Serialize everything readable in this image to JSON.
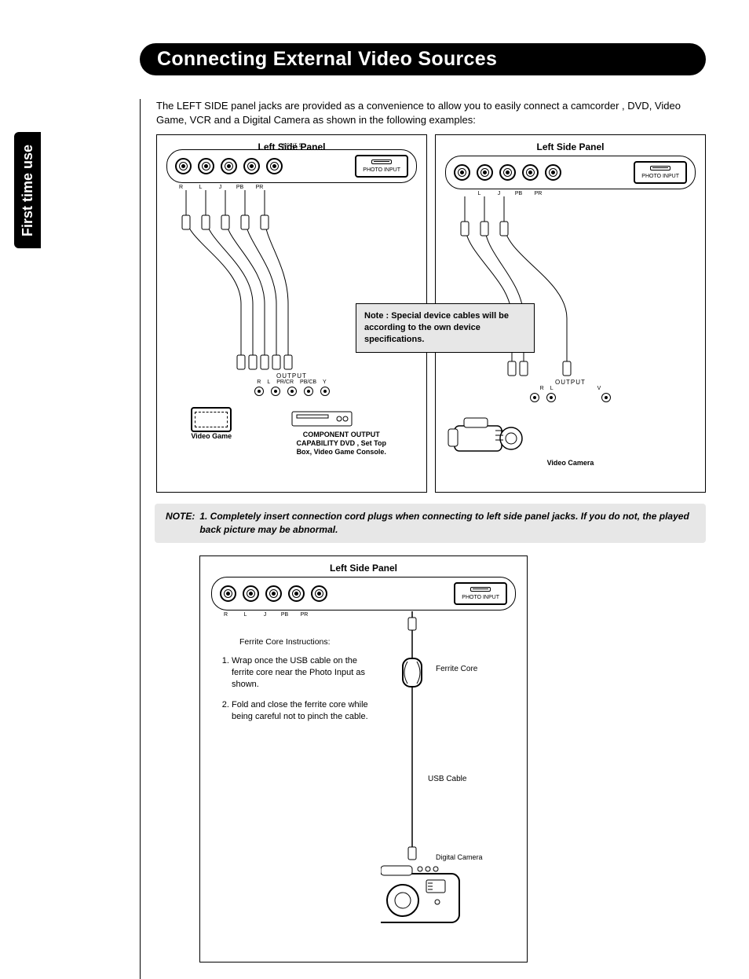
{
  "tab": "First time use",
  "title": "Connecting External Video Sources",
  "intro": "The LEFT SIDE panel jacks are provided as a convenience to allow you to easily connect a camcorder , DVD, Video Game, VCR  and a Digital  Camera as shown in the following examples:",
  "panel_label": "Left Side Panel",
  "inputs_label": "INPUT 5",
  "photo_input": "PHOTO INPUT",
  "jack_labels_full": [
    "R",
    "L",
    "J",
    "PB",
    "PR"
  ],
  "jack_labels_short": [
    "L",
    "J",
    "PB",
    "PR"
  ],
  "mid_note": "Note : Special device cables will be according to the own device specifications.",
  "output_label": "OUTPUT",
  "output_terms_left": [
    "R",
    "L",
    "PR/CR",
    "PB/CB",
    "Y"
  ],
  "output_terms_right": [
    "R",
    "L",
    "V"
  ],
  "device_video_game": "Video Game",
  "device_component": "COMPONENT OUTPUT CAPABILITY DVD , Set Top Box, Video Game Console.",
  "device_video_camera": "Video Camera",
  "note_label": "NOTE:",
  "note_text": "1.  Completely insert connection cord plugs when connecting to left side panel jacks. If you do not, the played back picture may be abnormal.",
  "ferrite_title": "Ferrite Core Instructions:",
  "ferrite_steps": [
    "Wrap once the USB cable on the ferrite core near the Photo Input as shown.",
    "Fold and close the ferrite core while being careful not to pinch the cable."
  ],
  "ferrite_core": "Ferrite Core",
  "usb_cable": "USB Cable",
  "digital_camera": "Digital Camera"
}
